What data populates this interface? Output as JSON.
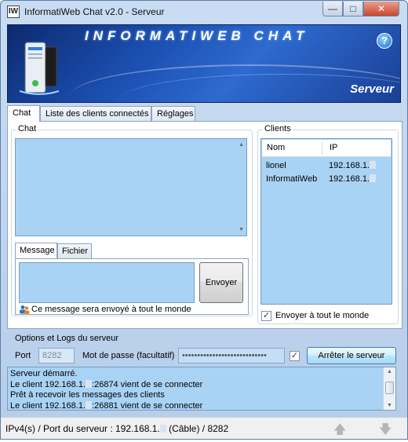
{
  "window": {
    "title": "InformatiWeb Chat v2.0 - Serveur",
    "app_icon": "IW",
    "minimize_glyph": "—",
    "maximize_glyph": "□",
    "close_glyph": "✕"
  },
  "banner": {
    "title": "INFORMATIWEB CHAT",
    "subtitle": "Serveur",
    "help_glyph": "?"
  },
  "tabs": [
    {
      "label": "Chat",
      "active": true
    },
    {
      "label": "Liste des clients connectés",
      "active": false
    },
    {
      "label": "Réglages",
      "active": false
    }
  ],
  "chat": {
    "group_label": "Chat",
    "inner_tabs": [
      {
        "label": "Message",
        "active": true
      },
      {
        "label": "Fichier",
        "active": false
      }
    ],
    "message_value": "",
    "send_button": "Envoyer",
    "broadcast_note": "Ce message sera envoyé à tout le monde"
  },
  "clients": {
    "group_label": "Clients",
    "columns": [
      "Nom",
      "IP"
    ],
    "rows": [
      {
        "name": "lionel",
        "ip": "192.168.1."
      },
      {
        "name": "InformatiWeb",
        "ip": "192.168.1."
      }
    ],
    "send_all_label": "Envoyer à tout le monde",
    "send_all_checked": true
  },
  "options": {
    "group_label": "Options et Logs du serveur",
    "port_label": "Port",
    "port_value": "8282",
    "password_label": "Mot de passe (facultatif)",
    "password_value": "••••••••••••••••••••••••••••",
    "password_checked": true,
    "stop_button": "Arrêter le serveur"
  },
  "logs": [
    {
      "pre": "Serveur démarré.",
      "masked": false,
      "post": ""
    },
    {
      "pre": "Le client 192.168.1.",
      "masked": true,
      "post": ":26874 vient de se connecter"
    },
    {
      "pre": "Prêt à recevoir les messages des clients",
      "masked": false,
      "post": ""
    },
    {
      "pre": "Le client 192.168.1.",
      "masked": true,
      "post": ":26881 vient de se connecter"
    }
  ],
  "status": {
    "pre": "IPv4(s) / Port du serveur : 192.168.1.",
    "post": " (Câble) / 8282"
  },
  "colors": {
    "accent_blue": "#a9d3f5",
    "window_frame": "#b6cde9",
    "banner_blue": "#1b4fb0"
  },
  "icons": {
    "help": "help-icon",
    "users": "users-icon",
    "up": "arrow-up-icon",
    "down": "arrow-down-icon"
  }
}
